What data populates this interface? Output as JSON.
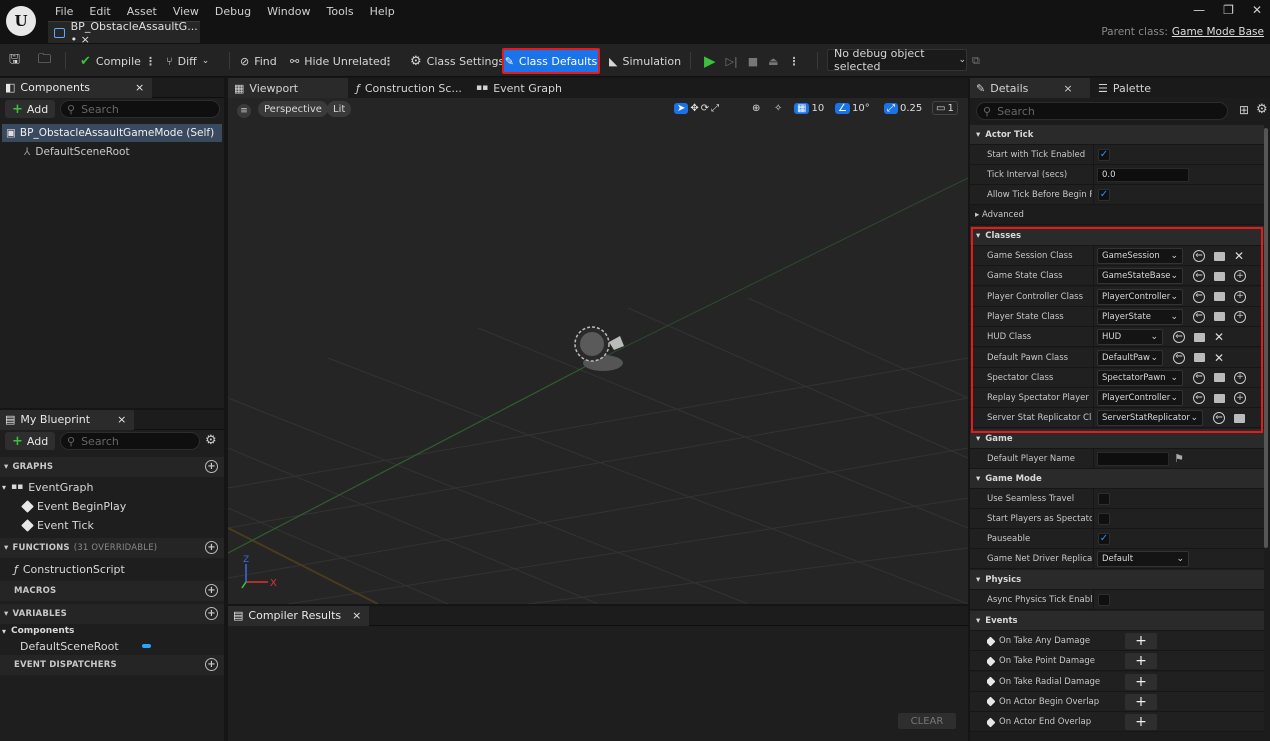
{
  "app": {
    "logo_letter": "U"
  },
  "menu": [
    "File",
    "Edit",
    "Asset",
    "View",
    "Debug",
    "Window",
    "Tools",
    "Help"
  ],
  "document_tab": {
    "title": "BP_ObstacleAssaultG... • ×"
  },
  "parent_class": {
    "label": "Parent class:",
    "value": "Game Mode Base"
  },
  "toolbar": {
    "compile": "Compile",
    "diff": "Diff",
    "find": "Find",
    "hide_unrelated": "Hide Unrelated",
    "class_settings": "Class Settings",
    "class_defaults": "Class Defaults",
    "simulation": "Simulation",
    "debug_object": "No debug object selected"
  },
  "components": {
    "tab": "Components",
    "add": "Add",
    "search_placeholder": "Search",
    "self": "BP_ObstacleAssaultGameMode (Self)",
    "root": "DefaultSceneRoot"
  },
  "my_blueprint": {
    "tab": "My Blueprint",
    "add": "Add",
    "search_placeholder": "Search",
    "graphs": "GRAPHS",
    "event_graph": "EventGraph",
    "event_begin_play": "Event BeginPlay",
    "event_tick": "Event Tick",
    "functions": "FUNCTIONS",
    "functions_count": "(31 OVERRIDABLE)",
    "construction_script": "ConstructionScript",
    "macros": "MACROS",
    "variables": "VARIABLES",
    "components_group": "Components",
    "default_scene_root": "DefaultSceneRoot",
    "event_dispatchers": "EVENT DISPATCHERS"
  },
  "viewport": {
    "tabs": [
      "Viewport",
      "Construction Sc...",
      "Event Graph"
    ],
    "perspective": "Perspective",
    "lit": "Lit",
    "grid_snap": "10",
    "rot_snap": "10°",
    "scale_snap": "0.25",
    "camera_speed": "1"
  },
  "compiler": {
    "tab": "Compiler Results",
    "clear": "CLEAR"
  },
  "details": {
    "tab": "Details",
    "palette_tab": "Palette",
    "search_placeholder": "Search",
    "actor_tick": "Actor Tick",
    "start_with_tick": "Start with Tick Enabled",
    "tick_interval": "Tick Interval (secs)",
    "tick_interval_value": "0.0",
    "allow_tick": "Allow Tick Before Begin Pl...",
    "advanced": "Advanced",
    "classes": "Classes",
    "class_rows": [
      {
        "label": "Game Session Class",
        "value": "GameSession"
      },
      {
        "label": "Game State Class",
        "value": "GameStateBase"
      },
      {
        "label": "Player Controller Class",
        "value": "PlayerController"
      },
      {
        "label": "Player State Class",
        "value": "PlayerState"
      },
      {
        "label": "HUD Class",
        "value": "HUD"
      },
      {
        "label": "Default Pawn Class",
        "value": "DefaultPaw"
      },
      {
        "label": "Spectator Class",
        "value": "SpectatorPawn"
      },
      {
        "label": "Replay Spectator Player C...",
        "value": "PlayerController"
      },
      {
        "label": "Server Stat Replicator Class",
        "value": "ServerStatReplicator"
      }
    ],
    "game": "Game",
    "default_player_name": "Default Player Name",
    "game_mode": "Game Mode",
    "use_seamless_travel": "Use Seamless Travel",
    "start_players_spectators": "Start Players as Spectators",
    "pauseable": "Pauseable",
    "game_net_driver": "Game Net Driver Replicati...",
    "game_net_driver_value": "Default",
    "physics": "Physics",
    "async_physics": "Async Physics Tick Enabled",
    "events": "Events",
    "event_rows": [
      "On Take Any Damage",
      "On Take Point Damage",
      "On Take Radial Damage",
      "On Actor Begin Overlap",
      "On Actor End Overlap"
    ]
  }
}
